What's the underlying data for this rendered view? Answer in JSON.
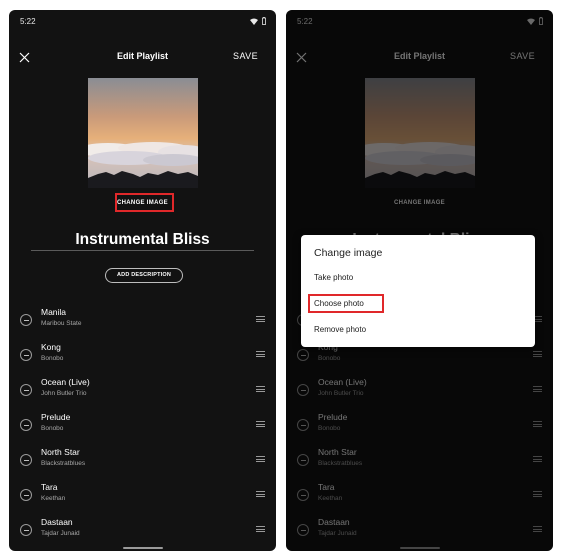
{
  "status_bar": {
    "time": "5:22"
  },
  "header": {
    "title": "Edit Playlist",
    "save_label": "SAVE"
  },
  "cover": {
    "change_image_label": "CHANGE IMAGE"
  },
  "playlist": {
    "name": "Instrumental Bliss",
    "add_description_label": "ADD DESCRIPTION"
  },
  "tracks": [
    {
      "title": "Manila",
      "artist": "Maribou State"
    },
    {
      "title": "Kong",
      "artist": "Bonobo"
    },
    {
      "title": "Ocean (Live)",
      "artist": "John Butler Trio"
    },
    {
      "title": "Prelude",
      "artist": "Bonobo"
    },
    {
      "title": "North Star",
      "artist": "Blackstratblues"
    },
    {
      "title": "Tara",
      "artist": "Keethan"
    },
    {
      "title": "Dastaan",
      "artist": "Tajdar Junaid"
    }
  ],
  "dialog": {
    "title": "Change image",
    "options": [
      "Take photo",
      "Choose photo",
      "Remove photo"
    ]
  },
  "colors": {
    "background": "#121212",
    "highlight": "#e0282a",
    "dialog_bg": "#ffffff"
  },
  "icons": {
    "close": "close-icon",
    "wifi": "wifi-icon",
    "battery": "battery-icon",
    "remove": "remove-circle-icon",
    "drag": "drag-handle-icon"
  }
}
